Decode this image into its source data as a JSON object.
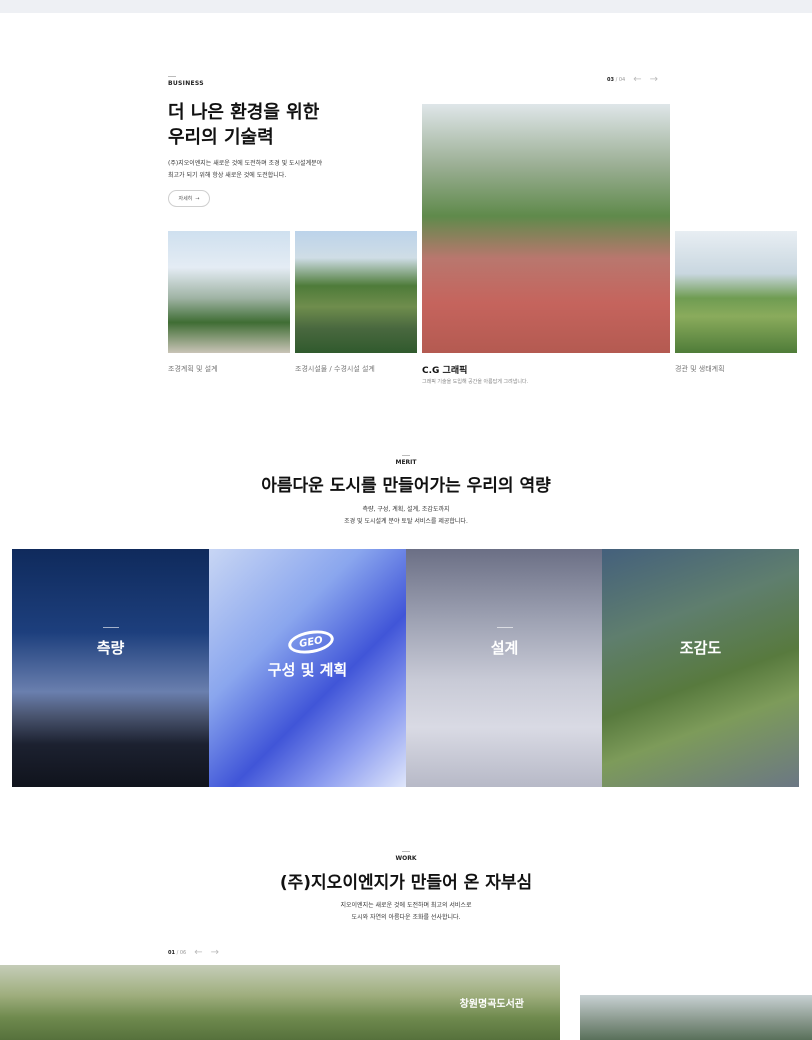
{
  "business": {
    "label": "BUSINESS",
    "title": "더 나은 환경을 위한\n우리의 기술력",
    "description": "(주)지오이엔지는 새로운 것에 도전하며 조경 및 도시설계분야\n최고가 되기 위해 항상 새로운 것에 도전합니다.",
    "more_label": "자세히",
    "pager": {
      "current": "03",
      "total": "/ 04"
    },
    "cards": [
      {
        "caption": "조경계획 및 설계"
      },
      {
        "caption": "조경시설물 / 수경시설 설계"
      },
      {
        "caption": "C.G 그래픽",
        "description": "그래픽 기술을 도입해 공간을 아름답게 그려냅니다."
      },
      {
        "caption": "경관 및 생태계획"
      }
    ]
  },
  "merit": {
    "label": "MERIT",
    "title": "아름다운 도시를 만들어가는 우리의 역량",
    "description": "측량, 구성, 계획, 설계, 조감도까지\n조경 및 도시설계 분야 토탈 서비스를 제공합니다.",
    "tiles": [
      {
        "label": "측량"
      },
      {
        "label": "구성 및 계획",
        "logo": "GEO"
      },
      {
        "label": "설계"
      },
      {
        "label": "조감도"
      }
    ]
  },
  "work": {
    "label": "WORK",
    "title": "(주)지오이엔지가 만들어 온 자부심",
    "description": "지오이엔지는 새로운 것에 도전하며 최고의 서비스로\n도시와 자연의 아름다운 조화를 선사합니다.",
    "pager": {
      "current": "01",
      "total": "/ 06"
    },
    "projects": [
      {
        "title": "창원명곡도서관"
      }
    ]
  }
}
